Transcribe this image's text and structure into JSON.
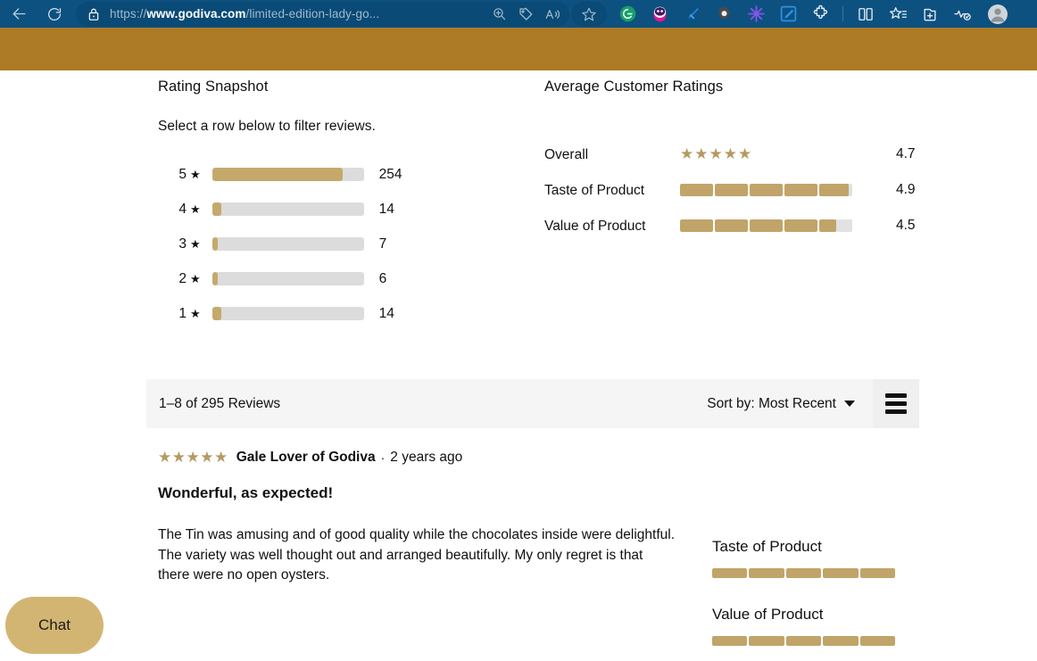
{
  "browser": {
    "back_icon": "back-arrow-icon",
    "reload_icon": "reload-icon",
    "url_lock_icon": "lock-icon",
    "url_prefix": "https://",
    "url_domain": "www.godiva.com",
    "url_path": "/limited-edition-lady-go...",
    "url_full": "https://www.godiva.com/limited-edition-lady-go...",
    "zoom_icon": "zoom-in-icon",
    "coupon_icon": "tag-icon",
    "read_aloud_icon": "read-aloud-icon",
    "favorite_icon": "star-outline-icon",
    "extensions": [
      "grammarly-icon",
      "honey-icon",
      "highlighter-pen-icon",
      "gear-icon",
      "asterisk-burst-icon",
      "edit-square-icon",
      "puzzle-piece-icon"
    ],
    "split_screen_icon": "split-screen-icon",
    "collections_icon": "favorites-list-icon",
    "add-collection_icon": "collections-add-icon",
    "browser_essentials_icon": "browser-essentials-icon",
    "profile_icon": "profile-avatar-icon"
  },
  "snapshot": {
    "title": "Rating Snapshot",
    "subtitle": "Select a row below to filter reviews.",
    "star_glyph": "★",
    "rows": [
      {
        "stars": "5",
        "count": "254",
        "percent": 86
      },
      {
        "stars": "4",
        "count": "14",
        "percent": 6
      },
      {
        "stars": "3",
        "count": "7",
        "percent": 3.5
      },
      {
        "stars": "2",
        "count": "6",
        "percent": 3.5
      },
      {
        "stars": "1",
        "count": "14",
        "percent": 6
      }
    ]
  },
  "averages": {
    "title": "Average Customer Ratings",
    "rows": [
      {
        "label": "Overall",
        "score": "4.7",
        "type": "stars",
        "stars": "★★★★★",
        "value": 4.7
      },
      {
        "label": "Taste of Product",
        "score": "4.9",
        "type": "segments",
        "value": 4.9
      },
      {
        "label": "Value of Product",
        "score": "4.5",
        "type": "segments",
        "value": 4.5
      }
    ]
  },
  "reviews_bar": {
    "count_text": "1–8 of 295 Reviews",
    "sort_label": "Sort by: Most Recent",
    "menu_icon": "hamburger-menu-icon"
  },
  "review": {
    "stars": "★★★★★",
    "rating_value": 5,
    "author": "Gale Lover of Godiva",
    "separator": "·",
    "age": "2 years ago",
    "title": "Wonderful, as expected!",
    "body": "The Tin was amusing and of good quality while the chocolates inside were delightful. The variety was well thought out and arranged beautifully. My only regret is that there were no open oysters.",
    "aspects": [
      {
        "name": "Taste of Product",
        "value": 5
      },
      {
        "name": "Value of Product",
        "value": 5
      }
    ]
  },
  "chat": {
    "label": "Chat"
  },
  "colors": {
    "toolbar_blue": "#0d5180",
    "urlbar_blue": "#0a4a76",
    "site_banner_gold": "#ad7a26",
    "bar_gold": "#c5a96b",
    "star_gold": "#b49a62",
    "track_gray": "#dcdcdc",
    "reviews_bar_gray": "#f5f5f5",
    "chat_gold": "#d3b573"
  }
}
